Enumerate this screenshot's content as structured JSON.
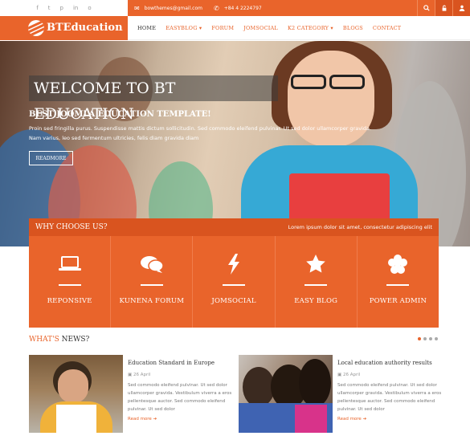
{
  "topbar": {
    "social_icons": [
      "facebook-icon",
      "twitter-icon",
      "pinterest-icon",
      "linkedin-icon",
      "instagram-icon"
    ],
    "social_glyphs": [
      "f",
      "t",
      "p",
      "in",
      "o"
    ],
    "email": "bowthemes@gmail.com",
    "phone": "+84 4 2224797"
  },
  "header": {
    "logo_text": "BTEducation",
    "nav": [
      {
        "label": "HOME",
        "active": true
      },
      {
        "label": "EASYBLOG ▾",
        "active": false
      },
      {
        "label": "FORUM",
        "active": false
      },
      {
        "label": "JOMSOCIAL",
        "active": false
      },
      {
        "label": "K2 CATEGORY ▾",
        "active": false
      },
      {
        "label": "BLOGS",
        "active": false
      },
      {
        "label": "CONTACT",
        "active": false
      }
    ]
  },
  "hero": {
    "title": "WELCOME TO BT EDUCATION",
    "subtitle": "BEST JOOMLA EDUCATION TEMPLATE!",
    "text_line1": "Proin sed fringilla purus. Suspendisse mattis dictum sollicitudin. Sed commodo eleifend pulvinar. Ut sed dolor ullamcorper gravida.",
    "text_line2": "Nam varius, leo sed fermentum ultricies, felis diam gravida diam",
    "button": "READMORE"
  },
  "why": {
    "title": "WHY CHOOSE US?",
    "lorem": "Lorem ipsum dolor sit amet, consectetur adipiscing elit",
    "features": [
      {
        "label": "REPONSIVE",
        "icon": "laptop-icon"
      },
      {
        "label": "KUNENA FORUM",
        "icon": "chat-bubbles-icon"
      },
      {
        "label": "JOMSOCIAL",
        "icon": "lightning-icon"
      },
      {
        "label": "EASY BLOG",
        "icon": "star-icon"
      },
      {
        "label": "POWER ADMIN",
        "icon": "flower-icon"
      }
    ]
  },
  "news": {
    "heading_prefix": "WHAT'S",
    "heading_suffix": "NEWS?",
    "cards": [
      {
        "title": "Education Standard in Europe",
        "date": "26 April",
        "text": "Sed commodo eleifend pulvinar. Ut sed dolor ullamcorper gravida. Vestibulum viverra a eros pellentesque auctor. Sed commodo eleifend pulvinar. Ut sed dolor",
        "readmore": "Read more"
      },
      {
        "title": "Local education authority results",
        "date": "26 April",
        "text": "Sed commodo eleifend pulvinar. Ut sed dolor ullamcorper gravida. Vestibulum viverra a eros pellentesque auctor. Sed commodo eleifend pulvinar. Ut sed dolor",
        "readmore": "Read more"
      }
    ]
  },
  "colors": {
    "accent": "#e9642b",
    "accent_dark": "#d9541f"
  }
}
